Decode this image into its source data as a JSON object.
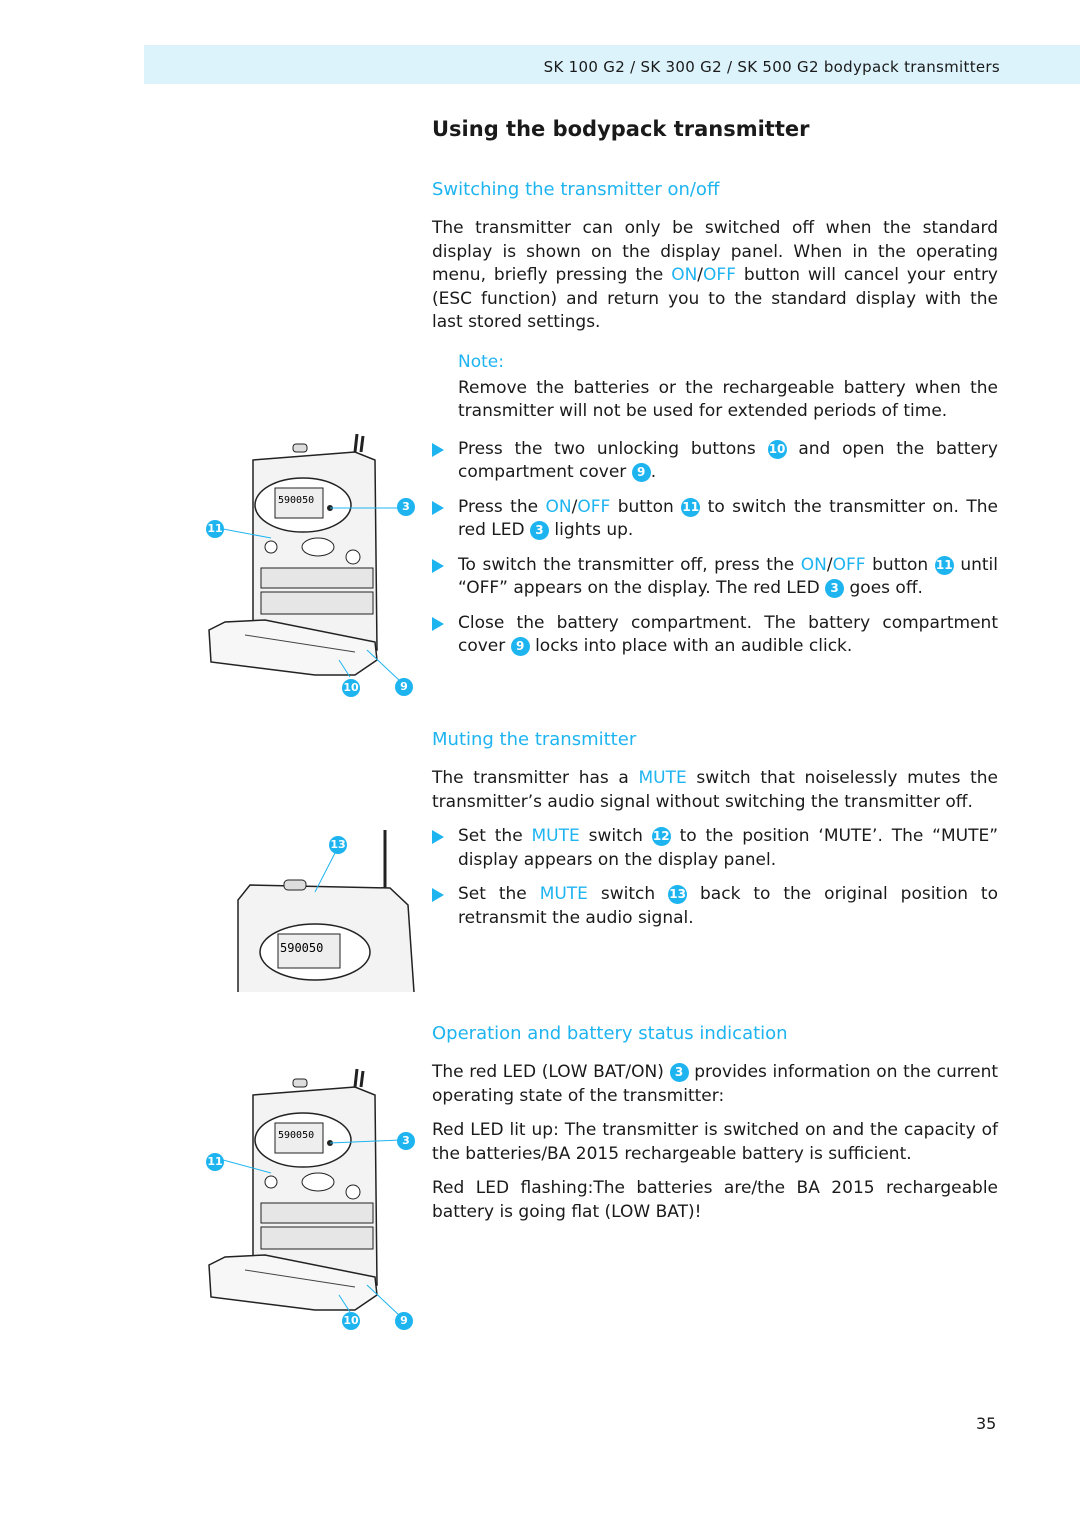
{
  "header": {
    "title": "SK 100 G2 / SK 300 G2 / SK 500 G2 bodypack transmitters"
  },
  "page_title": "Using the bodypack transmitter",
  "accent_color": "#1eb4f0",
  "sections": [
    {
      "heading": "Switching the transmitter on/off",
      "paras": [
        [
          {
            "t": "The transmitter can only be switched off when the standard display is shown on the display panel. When in the operating menu, briefly pressing the "
          },
          {
            "t": "ON",
            "s": "hl"
          },
          {
            "t": "/"
          },
          {
            "t": "OFF",
            "s": "hl"
          },
          {
            "t": " button will cancel your entry (ESC function) and return you to the standard display with the last stored settings."
          }
        ]
      ],
      "note": {
        "label": "Note:",
        "text": "Remove the batteries or the rechargeable battery when the transmitter will not be used for extended periods of time."
      },
      "bullets": [
        [
          {
            "t": "Press the two unlocking buttons "
          },
          {
            "t": "10",
            "s": "num"
          },
          {
            "t": " and open the battery compartment cover "
          },
          {
            "t": "9",
            "s": "num"
          },
          {
            "t": "."
          }
        ],
        [
          {
            "t": "Press the "
          },
          {
            "t": "ON",
            "s": "hl"
          },
          {
            "t": "/"
          },
          {
            "t": "OFF",
            "s": "hl"
          },
          {
            "t": " button "
          },
          {
            "t": "11",
            "s": "num"
          },
          {
            "t": " to switch the transmitter on. The red LED "
          },
          {
            "t": "3",
            "s": "num"
          },
          {
            "t": " lights up."
          }
        ],
        [
          {
            "t": "To switch the transmitter off, press the "
          },
          {
            "t": "ON",
            "s": "hl"
          },
          {
            "t": "/"
          },
          {
            "t": "OFF",
            "s": "hl"
          },
          {
            "t": " button "
          },
          {
            "t": "11",
            "s": "num"
          },
          {
            "t": " until “OFF” appears on the display. The red LED "
          },
          {
            "t": "3",
            "s": "num"
          },
          {
            "t": " goes off."
          }
        ],
        [
          {
            "t": "Close the battery compartment. The battery compartment cover "
          },
          {
            "t": "9",
            "s": "num"
          },
          {
            "t": " locks into place with an audible click."
          }
        ]
      ]
    },
    {
      "heading": "Muting the transmitter",
      "paras": [
        [
          {
            "t": "The transmitter has a "
          },
          {
            "t": "MUTE",
            "s": "hl"
          },
          {
            "t": " switch that noiselessly mutes the transmitter’s audio signal without switching the transmitter off."
          }
        ]
      ],
      "bullets": [
        [
          {
            "t": "Set the "
          },
          {
            "t": "MUTE",
            "s": "hl"
          },
          {
            "t": " switch "
          },
          {
            "t": "12",
            "s": "num"
          },
          {
            "t": " to the position ‘MUTE’. The “MUTE” display appears on the display panel."
          }
        ],
        [
          {
            "t": "Set the "
          },
          {
            "t": "MUTE",
            "s": "hl"
          },
          {
            "t": " switch "
          },
          {
            "t": "13",
            "s": "num"
          },
          {
            "t": " back to the original position to retransmit the audio signal."
          }
        ]
      ]
    },
    {
      "heading": "Operation and battery status indication",
      "paras": [
        [
          {
            "t": "The red LED (LOW BAT/ON) "
          },
          {
            "t": "3",
            "s": "num"
          },
          {
            "t": " provides information on the current operating state of the transmitter:"
          }
        ],
        [
          {
            "t": "Red LED lit up: The transmitter is switched on and the capacity of the batteries/BA 2015 rechargeable battery is sufficient."
          }
        ],
        [
          {
            "t": "Red LED flashing:The batteries are/the BA 2015 rechargeable battery is going flat (LOW BAT)!"
          }
        ]
      ],
      "bullets": []
    }
  ],
  "figures": [
    {
      "callouts": [
        "11",
        "3",
        "10",
        "9"
      ]
    },
    {
      "callouts": [
        "13"
      ]
    },
    {
      "callouts": [
        "11",
        "3",
        "10",
        "9"
      ]
    }
  ],
  "page_number": "35"
}
